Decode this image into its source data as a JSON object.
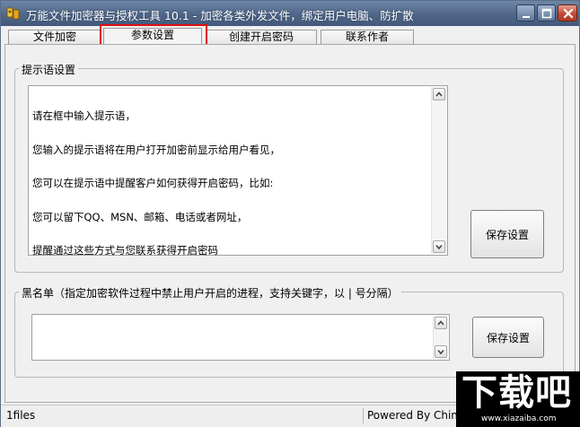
{
  "window": {
    "title": "万能文件加密器与授权工具 10.1 - 加密各类外发文件，绑定用户电脑、防扩散"
  },
  "tabs": [
    {
      "label": "文件加密",
      "active": false
    },
    {
      "label": "参数设置",
      "active": true
    },
    {
      "label": "创建开启密码",
      "active": false
    },
    {
      "label": "联系作者",
      "active": false
    }
  ],
  "prompt_group": {
    "legend": "提示语设置",
    "lines": [
      "请在框中输入提示语，",
      "您输入的提示语将在用户打开加密前显示给用户看见，",
      "您可以在提示语中提醒客户如何获得开启密码，比如:",
      "您可以留下QQ、MSN、邮箱、电话或者网址，",
      "提醒通过这些方式与您联系获得开启密码"
    ],
    "save_label": "保存设置"
  },
  "blacklist_group": {
    "legend": "黑名单（指定加密软件过程中禁止用户开启的进程，支持关键字，以 | 号分隔）",
    "value": "",
    "save_label": "保存设置"
  },
  "statusbar": {
    "files": "1files",
    "powered": "Powered By China"
  },
  "watermark": {
    "main": "下载吧",
    "sub": "www.xiazaiba.com"
  },
  "colors": {
    "title_bar": "#4f6688",
    "highlight": "#e01010",
    "close_button": "#c24a36"
  }
}
